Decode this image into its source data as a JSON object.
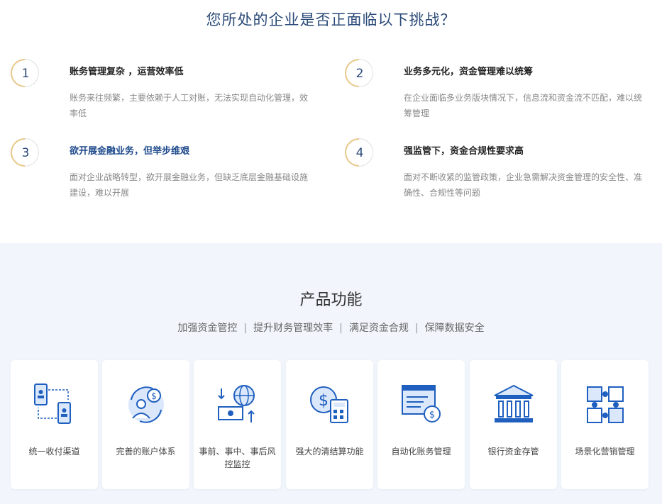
{
  "challenges": {
    "heading": "您所处的企业是否正面临以下挑战？",
    "items": [
      {
        "num": "1",
        "title": "账务管理复杂 ，运营效率低",
        "desc": "账务来往频繁，主要依赖于人工对账，无法实现自动化管理，效率低"
      },
      {
        "num": "2",
        "title": "业务多元化，资金管理难以统筹",
        "desc": "在企业面临多业务版块情况下，信息流和资金流不匹配，难以统筹管理"
      },
      {
        "num": "3",
        "title": "欲开展金融业务，但举步维艰",
        "desc": "面对企业战略转型，欲开展金融业务，但缺乏底层金融基础设施建设，难以开展"
      },
      {
        "num": "4",
        "title": "强监管下，资金合规性要求高",
        "desc": "面对不断收紧的监管政策，企业急需解决资金管理的安全性、准确性、合规性等问题"
      }
    ]
  },
  "products": {
    "title": "产品功能",
    "subtitle": [
      "加强资金管控",
      "提升财务管理效率",
      "满足资金合规",
      "保障数据安全"
    ],
    "separator": "|",
    "cards": [
      {
        "label": "统一收付渠道",
        "icon": "payment-channel-icon"
      },
      {
        "label": "完善的账户体系",
        "icon": "account-system-icon"
      },
      {
        "label": "事前、事中、事后风控监控",
        "icon": "risk-control-icon"
      },
      {
        "label": "强大的清结算功能",
        "icon": "settlement-icon"
      },
      {
        "label": "自动化账务管理",
        "icon": "auto-accounting-icon"
      },
      {
        "label": "银行资金存管",
        "icon": "bank-icon"
      },
      {
        "label": "场景化营销管理",
        "icon": "marketing-puzzle-icon"
      }
    ]
  },
  "colors": {
    "primary": "#1f5fbf",
    "accent": "#e8c98a",
    "band": "#f2f6fc",
    "title": "#2b4a78"
  }
}
